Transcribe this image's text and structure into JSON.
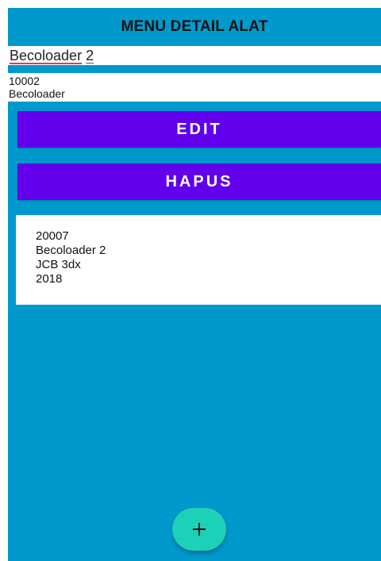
{
  "header": {
    "title": "MENU DETAIL ALAT"
  },
  "name_field": {
    "word1": "Becoloader",
    "word2": "2"
  },
  "info": {
    "code": "10002",
    "name": "Becoloader"
  },
  "buttons": {
    "edit": "EDIT",
    "delete": "HAPUS"
  },
  "card": {
    "code": "20007",
    "name": "Becoloader 2",
    "model": "JCB 3dx",
    "year": "2018"
  },
  "fab": {
    "icon": "plus-icon"
  },
  "colors": {
    "background": "#0099cc",
    "button": "#6200ee",
    "fab": "#1bd1b7"
  }
}
